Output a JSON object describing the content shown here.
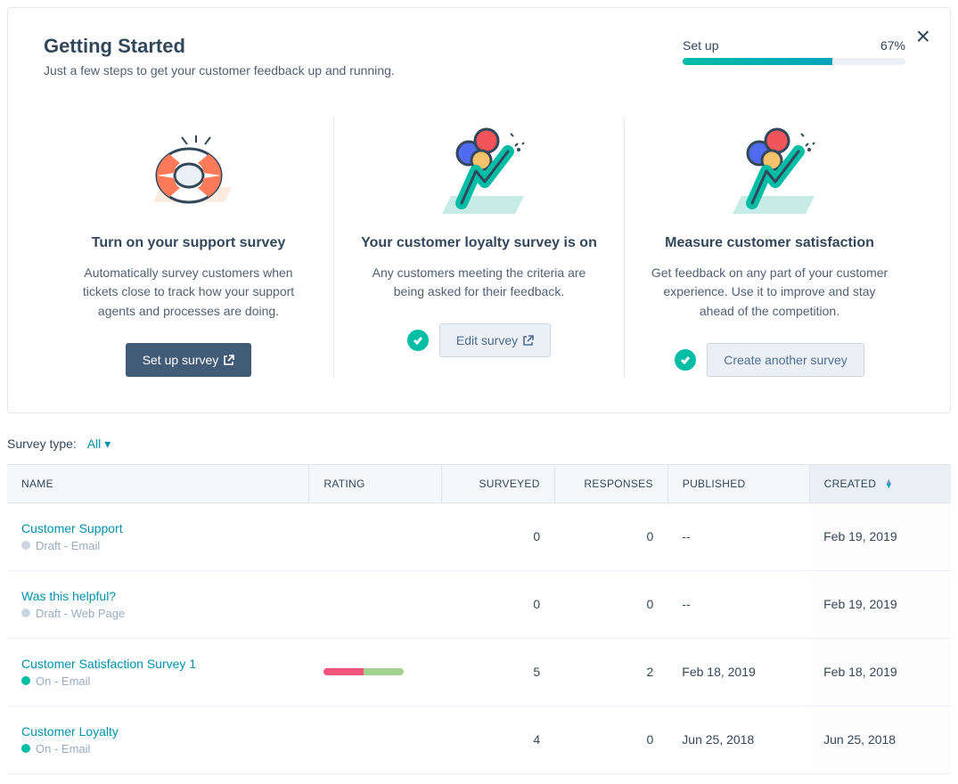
{
  "header": {
    "title": "Getting Started",
    "subtitle": "Just a few steps to get your customer feedback up and running.",
    "progress_label": "Set up",
    "progress_value": "67%",
    "progress_width": "67%"
  },
  "steps": [
    {
      "title": "Turn on your support survey",
      "desc": "Automatically survey customers when tickets close to track how your support agents and processes are doing.",
      "button": "Set up survey",
      "button_style": "primary",
      "completed": false
    },
    {
      "title": "Your customer loyalty survey is on",
      "desc": "Any customers meeting the criteria are being asked for their feedback.",
      "button": "Edit survey",
      "button_style": "secondary",
      "completed": true
    },
    {
      "title": "Measure customer satisfaction",
      "desc": "Get feedback on any part of your customer experience. Use it to improve and stay ahead of the competition.",
      "button": "Create another survey",
      "button_style": "secondary",
      "completed": true
    }
  ],
  "filter": {
    "label": "Survey type:",
    "value": "All"
  },
  "columns": {
    "name": "NAME",
    "rating": "RATING",
    "surveyed": "SURVEYED",
    "responses": "RESPONSES",
    "published": "PUBLISHED",
    "created": "CREATED"
  },
  "rows": [
    {
      "name": "Customer Support",
      "status_dot": "draft",
      "status_text": "Draft - Email",
      "rating": null,
      "surveyed": "0",
      "responses": "0",
      "published": "--",
      "created": "Feb 19, 2019"
    },
    {
      "name": "Was this helpful?",
      "status_dot": "draft",
      "status_text": "Draft - Web Page",
      "rating": null,
      "surveyed": "0",
      "responses": "0",
      "published": "--",
      "created": "Feb 19, 2019"
    },
    {
      "name": "Customer Satisfaction Survey 1",
      "status_dot": "on",
      "status_text": "On - Email",
      "rating": {
        "seg1": 50,
        "seg2": 50
      },
      "surveyed": "5",
      "responses": "2",
      "published": "Feb 18, 2019",
      "created": "Feb 18, 2019"
    },
    {
      "name": "Customer Loyalty",
      "status_dot": "on",
      "status_text": "On - Email",
      "rating": null,
      "surveyed": "4",
      "responses": "0",
      "published": "Jun 25, 2018",
      "created": "Jun 25, 2018"
    }
  ]
}
